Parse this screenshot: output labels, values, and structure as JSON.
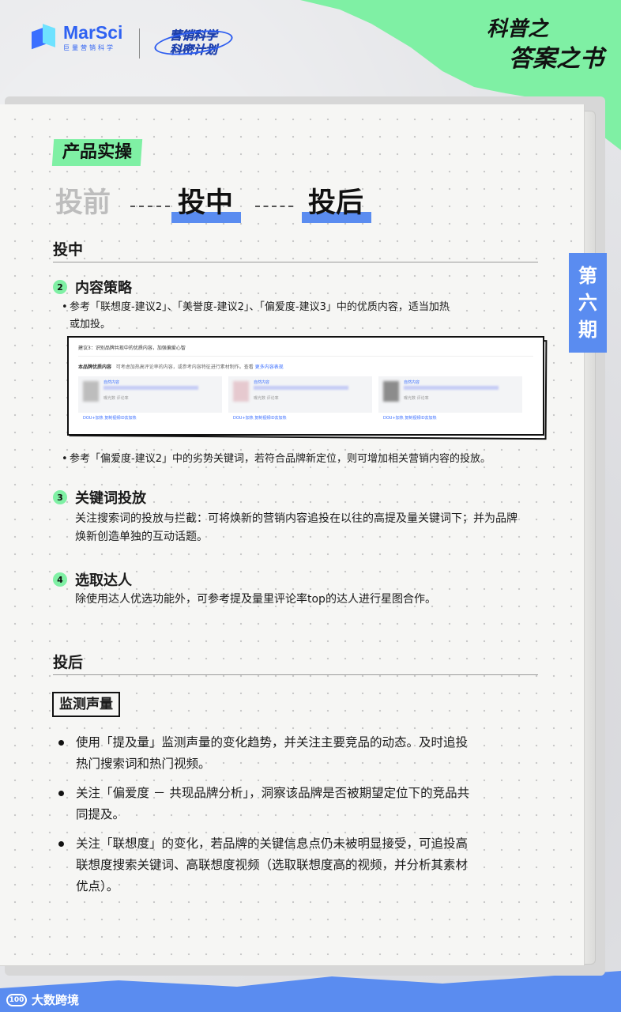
{
  "header": {
    "brand_name": "MarSci",
    "brand_sub": "巨量营销科学",
    "plan_line1": "营销科学",
    "plan_line2": "科密计划",
    "book_title_line1": "科普之",
    "book_title_line2": "答案之书"
  },
  "issue_tag": [
    "第",
    "六",
    "期"
  ],
  "section_tag": "产品实操",
  "phases": [
    "投前",
    "投中",
    "投后"
  ],
  "mid": {
    "heading": "投中",
    "item2": {
      "num": "2",
      "title": "内容策略",
      "bullet1_line1": "参考「联想度-建议2」、「美誉度-建议2」、「偏爱度-建议3」中的优质内容，适当加热",
      "bullet1_line2": "或加投。",
      "bullet2": "参考「偏爱度-建议2」中的劣势关键词，若符合品牌新定位，则可增加相关营销内容的投放。"
    },
    "screenshot": {
      "header": "建议3：识别品牌共现中的优质内容，加强偏爱心智",
      "row_label": "本品牌优质内容",
      "row_text": "可考虑加热高评论率的内容，或参考内容特征进行素材制作。查看",
      "row_link": "更多内容表现",
      "card_label": "自然内容",
      "card_meta": "曝光数    评论率",
      "card_links": "DOU+加热    复制视频ID去加热"
    },
    "item3": {
      "num": "3",
      "title": "关键词投放",
      "line1": "关注搜索词的投放与拦截：可将焕新的营销内容追投在以往的高提及量关键词下；并为品牌",
      "line2": "焕新创造单独的互动话题。"
    },
    "item4": {
      "num": "4",
      "title": "选取达人",
      "line1": "除使用达人优选功能外，可参考提及量里评论率top的达人进行星图合作。"
    }
  },
  "post": {
    "heading": "投后",
    "tag": "监测声量",
    "b1_line1": "使用「提及量」监测声量的变化趋势，并关注主要竞品的动态。及时追投",
    "b1_line2": "热门搜索词和热门视频。",
    "b2_line1": "关注「偏爱度 － 共现品牌分析」，洞察该品牌是否被期望定位下的竞品共",
    "b2_line2": "同提及。",
    "b3_line1": "关注「联想度」的变化，若品牌的关键信息点仍未被明显接受，可追投高",
    "b3_line2": "联想度搜索关键词、高联想度视频（选取联想度高的视频，并分析其素材",
    "b3_line3": "优点）。"
  },
  "footer": {
    "mark": "大数跨境",
    "badge": "100"
  },
  "colors": {
    "green": "#7ff0a4",
    "blue": "#5a8cf0",
    "brand_blue": "#2f62f2"
  }
}
